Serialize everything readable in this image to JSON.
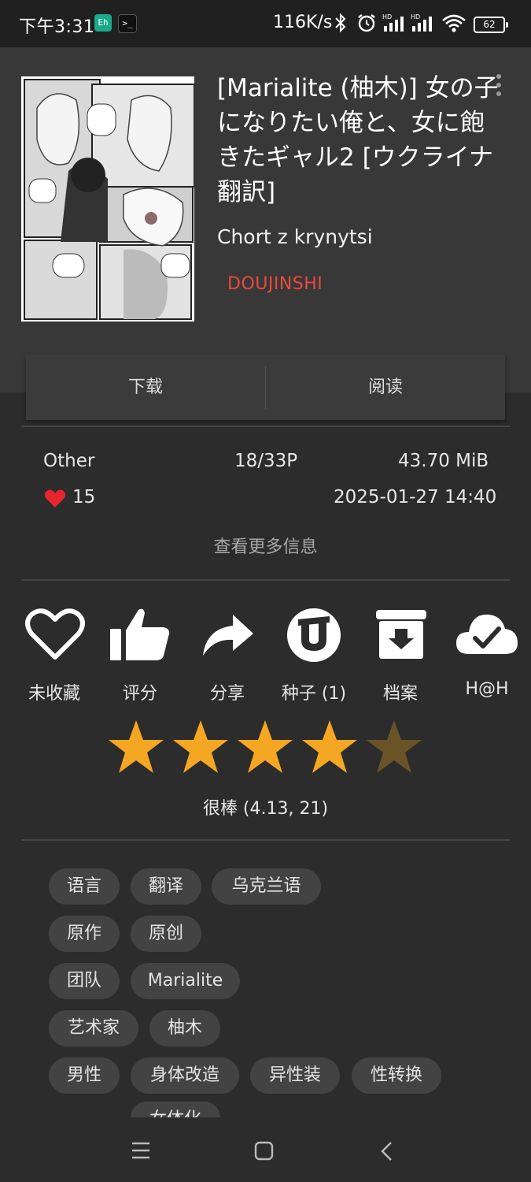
{
  "status_bar": {
    "time": "下午3:31",
    "app_badge_1": "Eh",
    "app_badge_2": ">_",
    "network_speed": "116K/s",
    "battery": "62"
  },
  "gallery": {
    "title": "[Marialite (柚木)] 女の子になりたい俺と、女に飽きたギャル2 [ウクライナ翻訳]",
    "uploader": "Chort z krynytsi",
    "category": "DOUJINSHI",
    "category_color": "#e84a3c"
  },
  "actions": {
    "download": "下载",
    "read": "阅读"
  },
  "info": {
    "language": "Other",
    "pages": "18/33P",
    "size": "43.70 MiB",
    "favorites": "15",
    "posted": "2025-01-27 14:40",
    "more_info": "查看更多信息"
  },
  "action_row": [
    {
      "label": "未收藏",
      "icon": "heart-outline-icon"
    },
    {
      "label": "评分",
      "icon": "thumbs-up-icon"
    },
    {
      "label": "分享",
      "icon": "share-arrow-icon"
    },
    {
      "label": "种子 (1)",
      "icon": "torrent-icon"
    },
    {
      "label": "档案",
      "icon": "archive-icon"
    },
    {
      "label": "H@H",
      "icon": "cloud-check-icon"
    }
  ],
  "rating": {
    "stars_filled": 4,
    "stars_total": 5,
    "text": "很棒 (4.13, 21)",
    "star_color": "#f5a623"
  },
  "tags": [
    {
      "namespace": "语言",
      "values": [
        "翻译",
        "乌克兰语"
      ]
    },
    {
      "namespace": "原作",
      "values": [
        "原创"
      ]
    },
    {
      "namespace": "团队",
      "values": [
        "Marialite"
      ]
    },
    {
      "namespace": "艺术家",
      "values": [
        "柚木"
      ]
    },
    {
      "namespace": "男性",
      "values": [
        "身体改造",
        "异性装",
        "性转换",
        "女体化"
      ]
    }
  ]
}
